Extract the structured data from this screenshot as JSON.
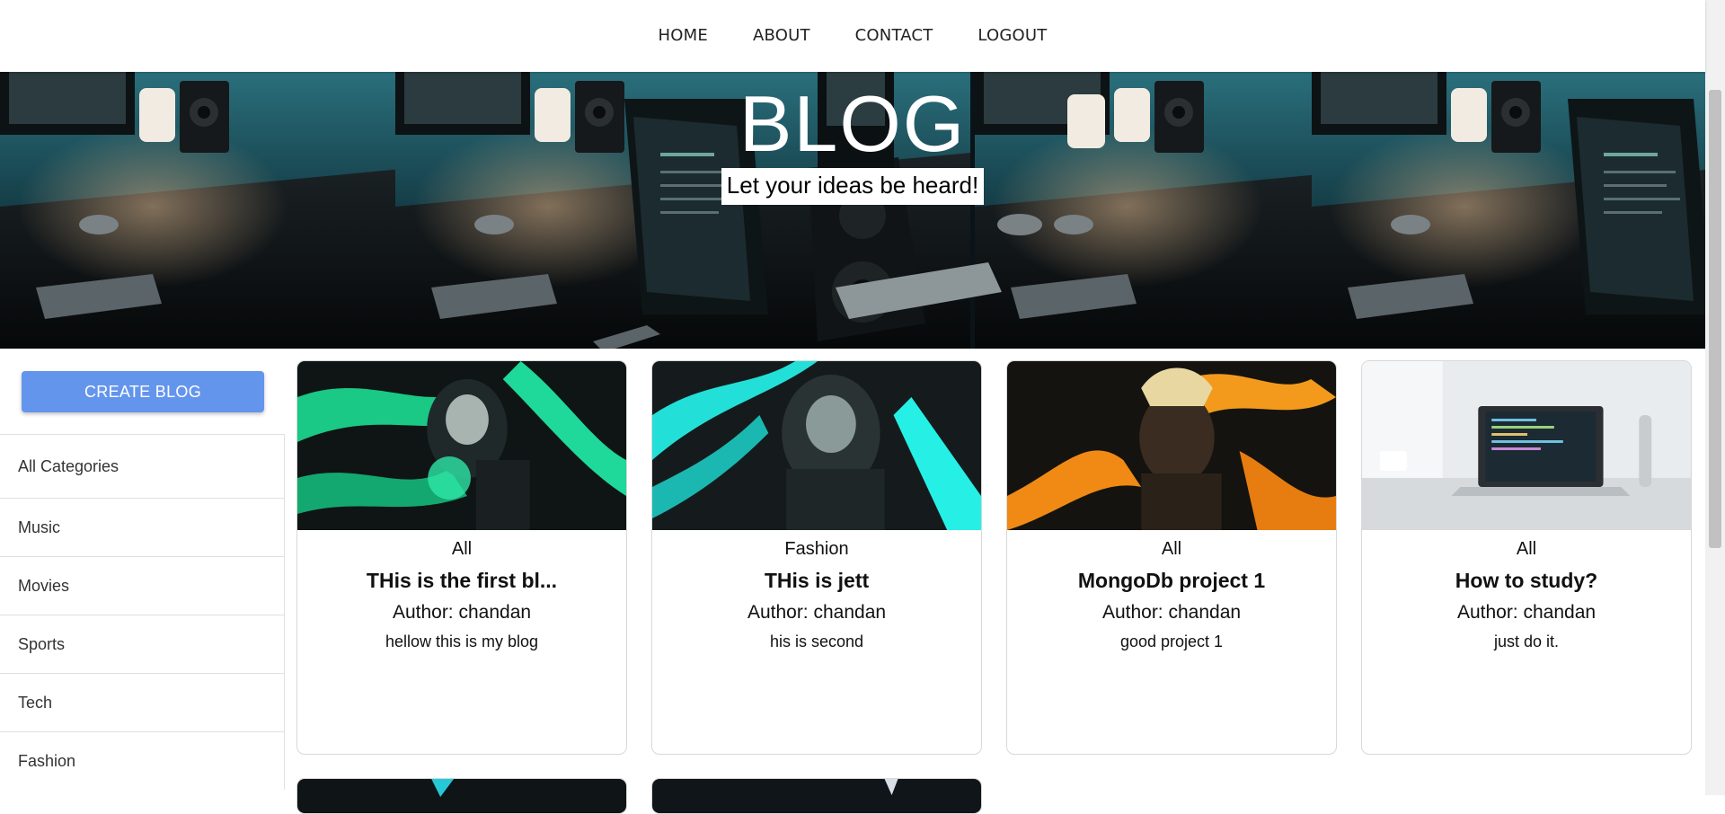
{
  "nav": {
    "items": [
      "HOME",
      "ABOUT",
      "CONTACT",
      "LOGOUT"
    ]
  },
  "hero": {
    "title": "BLOG",
    "subtitle": "Let your ideas be heard!"
  },
  "sidebar": {
    "create_label": "CREATE BLOG",
    "categories": [
      "All Categories",
      "Music",
      "Movies",
      "Sports",
      "Tech",
      "Fashion"
    ]
  },
  "posts": [
    {
      "category": "All",
      "title": "THis is the first bl...",
      "author": "Author: chandan",
      "description": "hellow this is my blog",
      "image": "green-anime-character"
    },
    {
      "category": "Fashion",
      "title": "THis is jett",
      "author": "Author: chandan",
      "description": "his is second",
      "image": "cyan-anime-character"
    },
    {
      "category": "All",
      "title": "MongoDb project 1",
      "author": "Author: chandan",
      "description": "good project 1",
      "image": "orange-anime-character"
    },
    {
      "category": "All",
      "title": "How to study?",
      "author": "Author: chandan",
      "description": "just do it.",
      "image": "laptop-on-desk"
    }
  ],
  "colors": {
    "accent": "#6495ed",
    "hero_dark": "#0a1418",
    "hero_teal": "#1f6a78"
  }
}
